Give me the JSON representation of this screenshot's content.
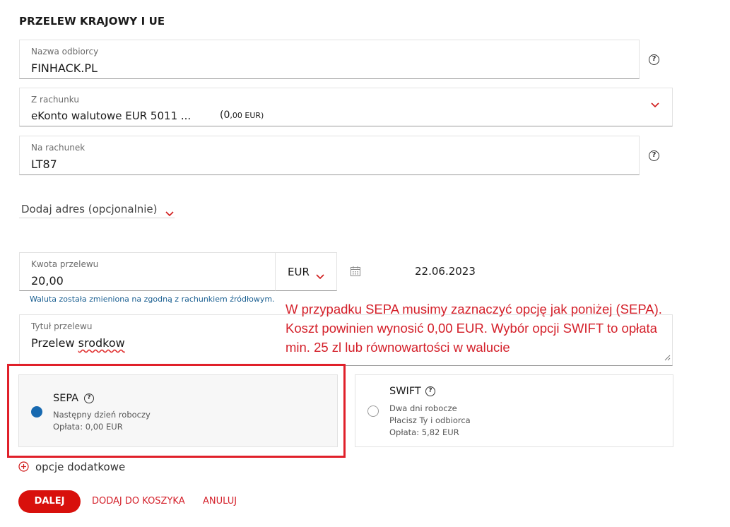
{
  "page_title": "PRZELEW KRAJOWY I UE",
  "recipient": {
    "label": "Nazwa odbiorcy",
    "value": "FINHACK.PL"
  },
  "from_account": {
    "label": "Z rachunku",
    "value": "eKonto walutowe EUR 5011 ...",
    "balance_prefix": "(0",
    "balance_suffix": ",00 EUR)"
  },
  "to_account": {
    "label": "Na rachunek",
    "value": "LT87"
  },
  "add_address": {
    "label": "Dodaj adres (opcjonalnie)"
  },
  "amount": {
    "label": "Kwota przelewu",
    "value": "20,00",
    "currency": "EUR",
    "note": "Waluta została zmieniona na zgodną z rachunkiem źródłowym."
  },
  "date": {
    "value": "22.06.2023"
  },
  "title_field": {
    "label": "Tytuł przelewu",
    "value_plain": "Przelew ",
    "value_misspelled": "srodkow"
  },
  "annotation": {
    "line1": "W przypadku SEPA musimy zaznaczyć opcję jak poniżej (SEPA).",
    "line2": "Koszt powinien wynosić 0,00 EUR. Wybór opcji SWIFT to opłata",
    "line3": "min. 25 zl lub równowartości w walucie"
  },
  "options": {
    "sepa": {
      "title": "SEPA",
      "line1": "Następny dzień roboczy",
      "line2": "Opłata: 0,00 EUR",
      "selected": true
    },
    "swift": {
      "title": "SWIFT",
      "line1": "Dwa dni robocze",
      "line2": "Płacisz Ty i odbiorca",
      "line3": "Opłata: 5,82 EUR",
      "selected": false
    }
  },
  "extra_options": {
    "label": "opcje dodatkowe"
  },
  "actions": {
    "next": "DALEJ",
    "add_to_cart": "DODAJ DO KOSZYKA",
    "cancel": "ANULUJ"
  },
  "colors": {
    "accent_red": "#d8100c",
    "radio_blue": "#1769b0",
    "annotation_red": "#d4202a",
    "note_blue": "#1a5f91"
  },
  "icons": [
    "help-icon",
    "chevron-down-icon",
    "calendar-icon",
    "plus-circle-icon",
    "textarea-resize-icon"
  ]
}
